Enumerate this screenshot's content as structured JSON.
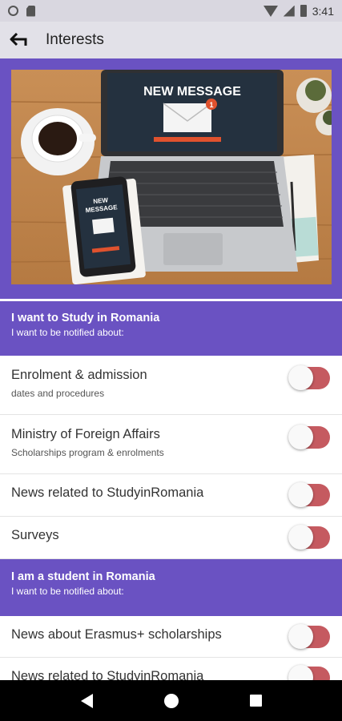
{
  "status_bar": {
    "icons": [
      "notification-circle-icon",
      "sd-card-icon",
      "wifi-icon",
      "signal-icon",
      "battery-icon"
    ],
    "time": "3:41"
  },
  "app_bar": {
    "back_icon": "back-arrow-icon",
    "title": "Interests"
  },
  "hero": {
    "laptop_screen_text": "NEW MESSAGE",
    "phone_screen_text_line1": "NEW",
    "phone_screen_text_line2": "MESSAGE",
    "badge": "1"
  },
  "sections": [
    {
      "title": "I want to Study in Romania",
      "subtitle": "I want to be notified about:",
      "items": [
        {
          "title": "Enrolment & admission",
          "subtitle": "dates and procedures",
          "enabled": false
        },
        {
          "title": "Ministry of Foreign Affairs",
          "subtitle": "Scholarships program & enrolments",
          "enabled": false
        },
        {
          "title": "News related to StudyinRomania",
          "enabled": false
        },
        {
          "title": "Surveys",
          "enabled": false
        }
      ]
    },
    {
      "title": "I am a student in Romania",
      "subtitle": "I want to be notified about:",
      "items": [
        {
          "title": "News about Erasmus+ scholarships",
          "enabled": false
        },
        {
          "title": "News related to StudyinRomania",
          "enabled": false
        }
      ]
    }
  ],
  "colors": {
    "accent_purple": "#6a52c2",
    "toggle_off_track": "#c55a60",
    "app_bar_bg": "#e2e1e8",
    "status_bar_bg": "#d9d7e0"
  },
  "nav_bar": {
    "icons": [
      "nav-back-icon",
      "nav-home-icon",
      "nav-recents-icon"
    ]
  }
}
